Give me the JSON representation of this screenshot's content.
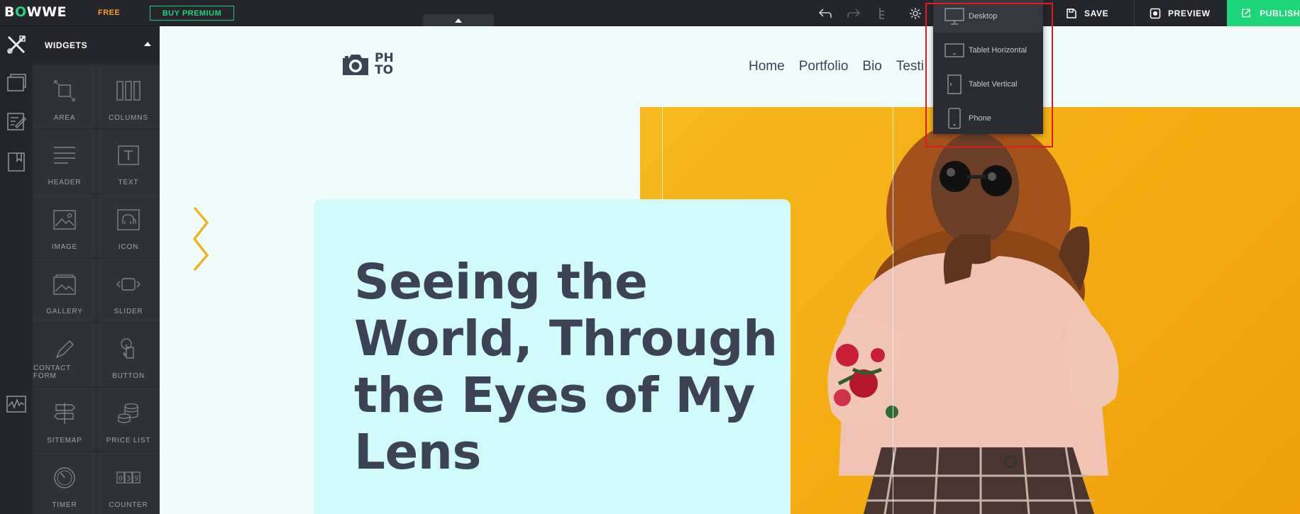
{
  "topbar": {
    "logo_prefix": "B",
    "logo_o": "O",
    "logo_suffix": "WWE",
    "plan_badge": "FREE",
    "premium_button": "BUY PREMIUM",
    "save": "SAVE",
    "preview": "PREVIEW",
    "publish": "PUBLISH"
  },
  "widgets_panel": {
    "title": "WIDGETS",
    "items": [
      {
        "label": "AREA",
        "icon": "area-icon"
      },
      {
        "label": "COLUMNS",
        "icon": "columns-icon"
      },
      {
        "label": "HEADER",
        "icon": "header-icon"
      },
      {
        "label": "TEXT",
        "icon": "text-icon"
      },
      {
        "label": "IMAGE",
        "icon": "image-icon"
      },
      {
        "label": "ICON",
        "icon": "elephant-icon"
      },
      {
        "label": "GALLERY",
        "icon": "gallery-icon"
      },
      {
        "label": "SLIDER",
        "icon": "slider-icon"
      },
      {
        "label": "CONTACT FORM",
        "icon": "contact-form-icon"
      },
      {
        "label": "BUTTON",
        "icon": "button-icon"
      },
      {
        "label": "SITEMAP",
        "icon": "sitemap-icon"
      },
      {
        "label": "PRICE LIST",
        "icon": "price-list-icon"
      },
      {
        "label": "TIMER",
        "icon": "timer-icon"
      },
      {
        "label": "COUNTER",
        "icon": "counter-icon"
      }
    ]
  },
  "device_menu": {
    "items": [
      {
        "label": "Desktop",
        "icon": "desktop-icon",
        "active": true
      },
      {
        "label": "Tablet Horizontal",
        "icon": "tablet-horizontal-icon",
        "active": false
      },
      {
        "label": "Tablet Vertical",
        "icon": "tablet-vertical-icon",
        "active": false
      },
      {
        "label": "Phone",
        "icon": "phone-icon",
        "active": false
      }
    ]
  },
  "site": {
    "logo_line1": "PH",
    "logo_line2": "TO",
    "nav": [
      "Home",
      "Portfolio",
      "Bio",
      "Testi"
    ],
    "headline_lines": [
      "Seeing the",
      "World, Through",
      "the Eyes of My",
      "Lens"
    ]
  },
  "colors": {
    "accent_green": "#1ed67a",
    "free_orange": "#ff9a2e",
    "hero_yellow": "#f4ad12",
    "card_cyan": "#d1fafb",
    "text_dark": "#3d4356",
    "highlight_red": "#e01b1b"
  }
}
